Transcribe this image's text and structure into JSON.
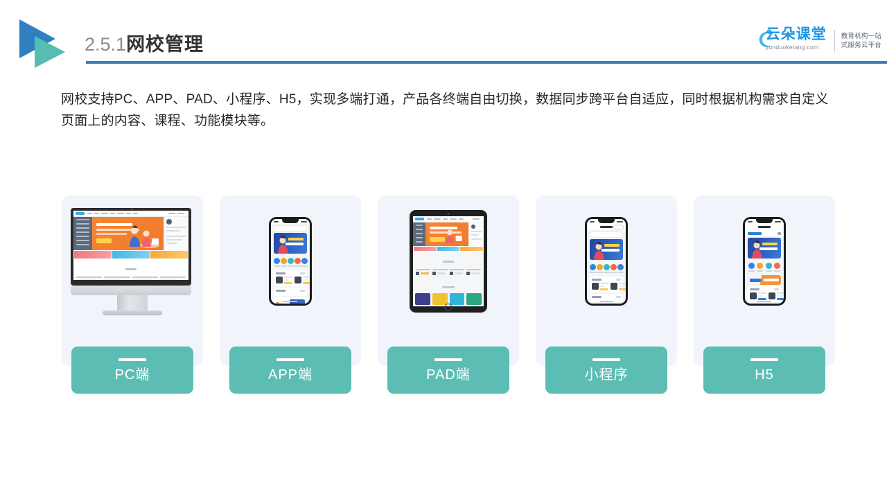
{
  "header": {
    "title_number": "2.5.1",
    "title_text": "网校管理",
    "brand": {
      "name": "云朵课堂",
      "domain": "yunduoketang.com",
      "tagline_line1": "教育机构一站",
      "tagline_line2": "式服务云平台"
    },
    "accent_blue": "#3a7fbd",
    "logo_triangle_blue": "#2f7fc1",
    "logo_triangle_teal": "#55bdb4"
  },
  "body": {
    "paragraph": "网校支持PC、APP、PAD、小程序、H5，实现多端打通，产品各终端自由切换，数据同步跨平台自适应，同时根据机构需求自定义页面上的内容、课程、功能模块等。"
  },
  "cards": {
    "label_color": "#5cbdb5",
    "panel_color": "#f1f4fa",
    "items": [
      {
        "label": "PC端",
        "device": "desktop-monitor"
      },
      {
        "label": "APP端",
        "device": "smartphone"
      },
      {
        "label": "PAD端",
        "device": "tablet"
      },
      {
        "label": "小程序",
        "device": "smartphone-miniprogram"
      },
      {
        "label": "H5",
        "device": "smartphone-h5"
      }
    ]
  }
}
